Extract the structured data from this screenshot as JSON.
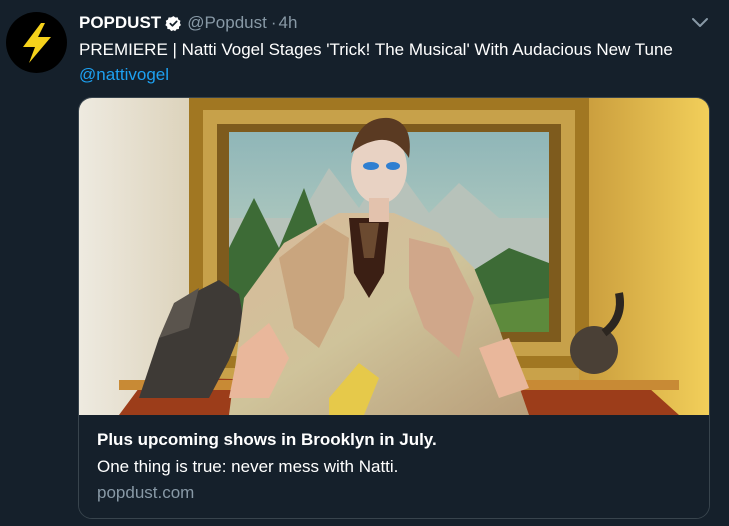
{
  "tweet": {
    "author": {
      "name": "POPDUST",
      "handle": "@Popdust",
      "verified": true,
      "avatar_icon": "lightning-bolt-icon",
      "avatar_colors": {
        "background": "#000000",
        "bolt": "#f6d21b"
      }
    },
    "separator": "·",
    "time": "4h",
    "text": "PREMIERE | Natti Vogel Stages 'Trick! The Musical' With Audacious New Tune",
    "mention": "@nattivogel",
    "menu_icon": "chevron-down-icon"
  },
  "card": {
    "image_description_icon": "card-photo",
    "title": "Plus upcoming shows in Brooklyn in July.",
    "description": "One thing is true: never mess with Natti.",
    "domain": "popdust.com"
  },
  "colors": {
    "background": "#15202b",
    "text": "#ffffff",
    "secondary": "#8899a6",
    "link": "#1da1f2",
    "border": "#38444d",
    "verified": "#1da1f2"
  }
}
